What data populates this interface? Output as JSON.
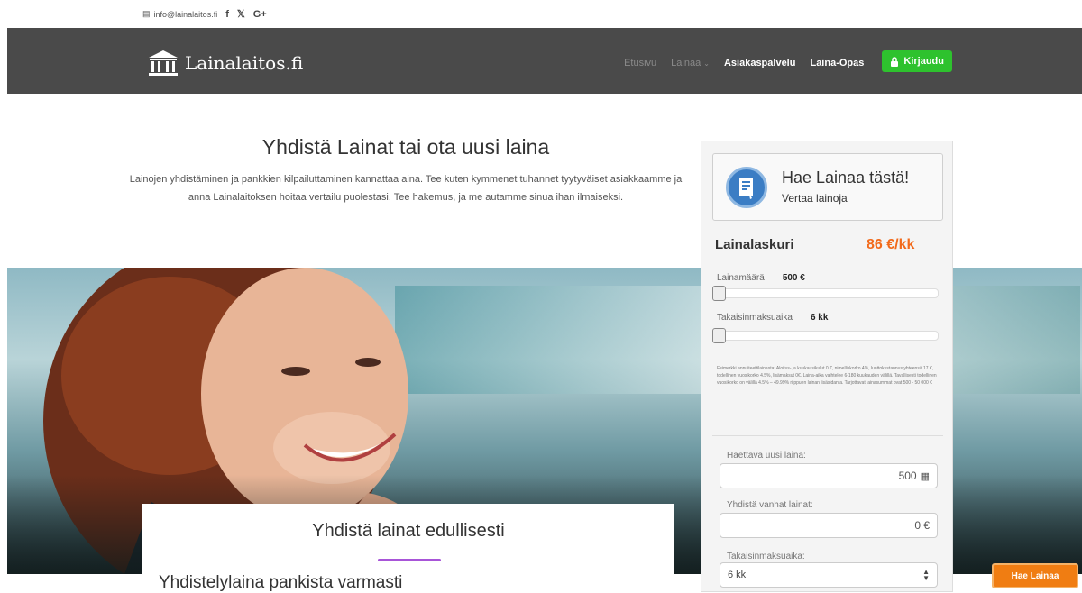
{
  "topbar": {
    "email": "info@lainalaitos.fi",
    "social": [
      "f",
      "𝕏",
      "G+"
    ]
  },
  "header": {
    "brand": "Lainalaitos.fi",
    "nav": [
      {
        "label": "Etusivu",
        "active": false
      },
      {
        "label": "Lainaa",
        "active": false,
        "dropdown": true
      },
      {
        "label": "Asiakaspalvelu",
        "active": true
      },
      {
        "label": "Laina-Opas",
        "active": true
      }
    ],
    "login_label": "Kirjaudu"
  },
  "intro": {
    "title": "Yhdistä Lainat tai ota uusi laina",
    "text": "Lainojen yhdistäminen ja pankkien kilpailuttaminen kannattaa aina. Tee kuten kymmenet tuhannet tyytyväiset asiakkaamme ja anna Lainalaitoksen hoitaa vertailu puolestasi. Tee hakemus, ja me autamme sinua ihan ilmaiseksi."
  },
  "content_card": {
    "title": "Yhdistä lainat edullisesti",
    "subtitle": "Yhdistelylaina pankista varmasti"
  },
  "panel": {
    "apply_title": "Hae Lainaa tästä!",
    "apply_subtitle": "Vertaa lainoja",
    "calc_title": "Lainalaskuri",
    "monthly": "86 €/kk",
    "amount_label": "Lainamäärä",
    "amount_value": "500 €",
    "amount_fraction": 0,
    "term_label": "Takaisinmaksuaika",
    "term_value": "6 kk",
    "term_fraction": 0,
    "fineprint": "Esimerkki annuiteettilainasta: Aloitus- ja kuukausikulut 0 €, nimelliskorko 4%, luottokustannus yhteensä 17 €, todellinen vuosikorko 4.5%, lisämaksut 0€. Laina-aika vaihtelee 6-180 kuukauden välillä. Tavallisesti todellinen vuosikorko on välillä 4.5% – 49.99% riippuen lainan lisäsidanta. Tarjottavat lainasummat ovat 500 - 50 000 €",
    "new_loan_label": "Haettava uusi laina:",
    "new_loan_value": "500",
    "old_loans_label": "Yhdistä vanhat lainat:",
    "old_loans_value": "0 €",
    "term_select_label": "Takaisinmaksuaika:",
    "term_select_value": "6 kk"
  },
  "floating_button": "Hae Lainaa"
}
